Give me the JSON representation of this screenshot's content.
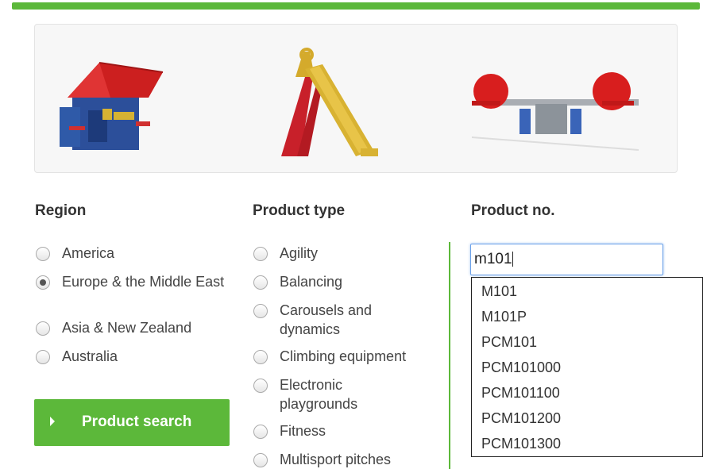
{
  "filters": {
    "region": {
      "heading": "Region",
      "options": [
        "America",
        "Europe & the Middle East",
        "Asia & New Zealand",
        "Australia"
      ],
      "selected": "Europe & the Middle East"
    },
    "product_type": {
      "heading": "Product type",
      "options": [
        "Agility",
        "Balancing",
        "Carousels and dynamics",
        "Climbing equipment",
        "Electronic playgrounds",
        "Fitness",
        "Multisport pitches"
      ]
    },
    "product_no": {
      "heading": "Product no.",
      "value": "m101",
      "suggestions": [
        "M101",
        "M101P",
        "PCM101",
        "PCM101000",
        "PCM101100",
        "PCM101200",
        "PCM101300"
      ]
    }
  },
  "search_button": {
    "label": "Product search"
  },
  "banner_images": [
    "playhouse-image",
    "slide-image",
    "seesaw-image"
  ],
  "colors": {
    "accent": "#5cb83a",
    "focus": "#6aa0e8"
  }
}
